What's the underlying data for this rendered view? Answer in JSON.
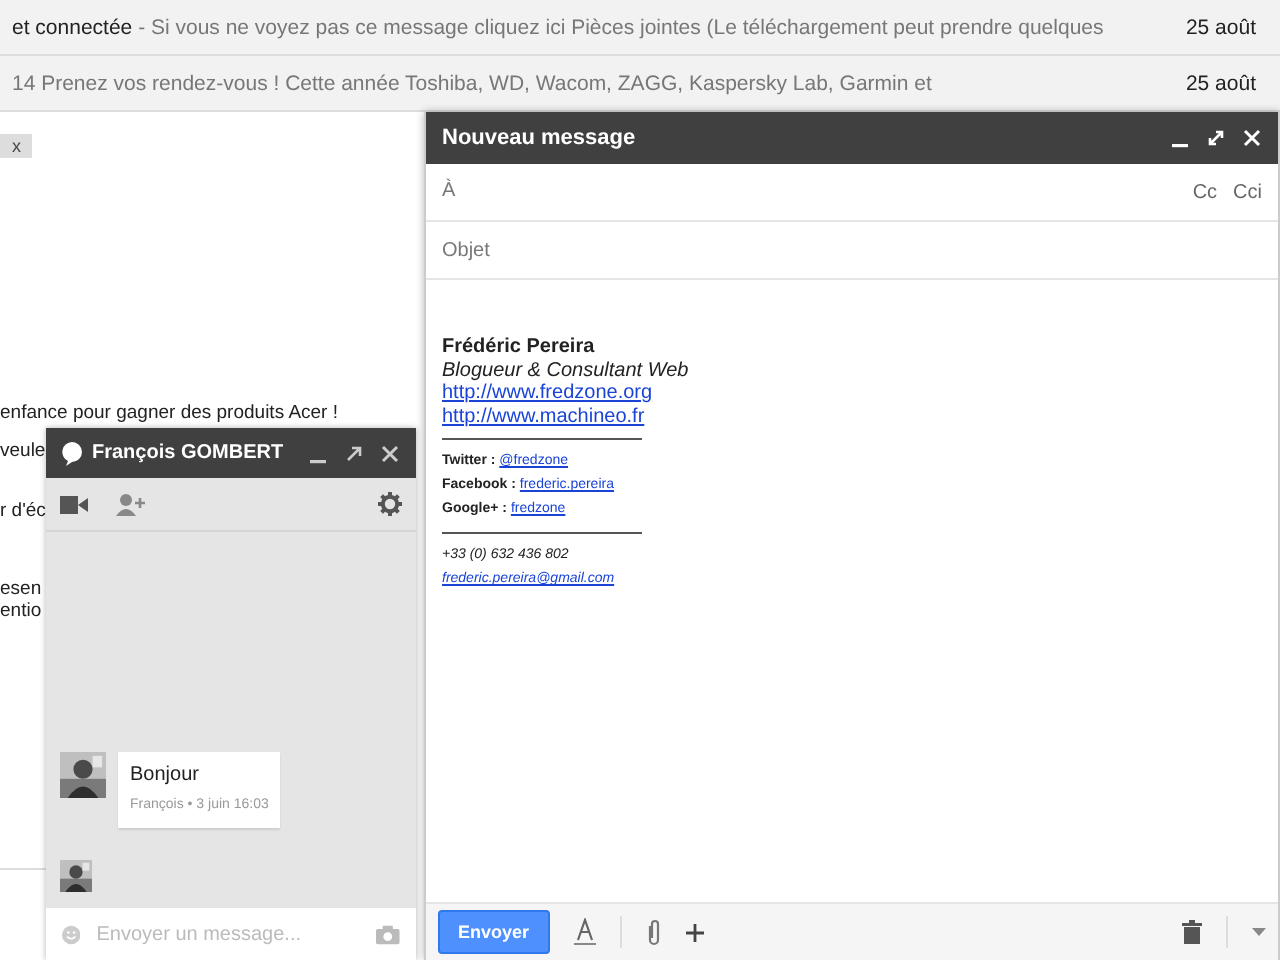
{
  "email_list": {
    "rows": [
      {
        "sender": "et connectée",
        "snippet": "- Si vous ne voyez pas ce message cliquez ici Pièces jointes (Le téléchargement peut prendre quelques",
        "date": "25 août"
      },
      {
        "snippet": "14 Prenez vos rendez-vous ! Cette année Toshiba, WD, Wacom, ZAGG, Kaspersky Lab, Garmin et",
        "date": "25 août"
      }
    ]
  },
  "label_chip": {
    "close": "x"
  },
  "message_body": {
    "lines": [
      "enfance pour gagner des produits Acer !",
      "veule",
      "r d'éc",
      "esen",
      "entio"
    ]
  },
  "compose": {
    "title": "Nouveau message",
    "to_label": "À",
    "cc": "Cc",
    "bcc": "Cci",
    "subject_placeholder": "Objet",
    "signature": [
      {
        "kind": "name",
        "text": "Frédéric Pereira"
      },
      {
        "kind": "tagline",
        "text": "Blogueur & Consultant Web"
      },
      {
        "kind": "link",
        "text": "http://www.fredzone.org"
      },
      {
        "kind": "link",
        "text": "http://www.machineo.fr"
      },
      {
        "kind": "rule"
      },
      {
        "kind": "social",
        "label": "Twitter :",
        "link": "@fredzone"
      },
      {
        "kind": "social",
        "label": "Facebook :",
        "link": "frederic.pereira"
      },
      {
        "kind": "social",
        "label": "Google+ :",
        "link": "fredzone"
      },
      {
        "kind": "rule"
      },
      {
        "kind": "phone",
        "text": "+33 (0) 632 436 802"
      },
      {
        "kind": "email",
        "text": "frederic.pereira@gmail.com"
      }
    ],
    "send": "Envoyer"
  },
  "chat": {
    "title": "François GOMBERT",
    "messages": [
      {
        "text": "Bonjour",
        "meta": "François • 3 juin 16:03"
      }
    ],
    "placeholder": "Envoyer un message..."
  }
}
